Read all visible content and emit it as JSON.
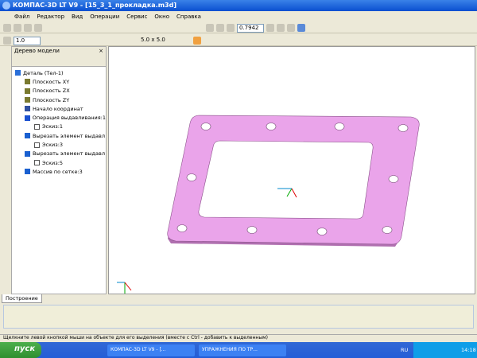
{
  "window": {
    "title": "КОМПАС-3D LT V9 - [15_3_1_прокладка.m3d]"
  },
  "menu": [
    "Файл",
    "Редактор",
    "Вид",
    "Операции",
    "Сервис",
    "Окно",
    "Справка"
  ],
  "toolbar": {
    "zoom": "0.7942",
    "line_step": "1.0",
    "grid": "5.0 x 5.0"
  },
  "tree": {
    "title": "Дерево модели",
    "items": [
      {
        "label": "Деталь (Тел-1)",
        "icon": "part-icon",
        "level": 0
      },
      {
        "label": "Плоскость XY",
        "icon": "plane-icon",
        "level": 1
      },
      {
        "label": "Плоскость ZX",
        "icon": "plane-icon",
        "level": 1
      },
      {
        "label": "Плоскость ZY",
        "icon": "plane-icon",
        "level": 1
      },
      {
        "label": "Начало координат",
        "icon": "origin-icon",
        "level": 1
      },
      {
        "label": "Операция выдавливания:1",
        "icon": "extrude-icon",
        "level": 1
      },
      {
        "label": "Эскиз:1",
        "icon": "sketch-icon",
        "level": 2
      },
      {
        "label": "Вырезать элемент выдавл",
        "icon": "cut-icon",
        "level": 1
      },
      {
        "label": "Эскиз:3",
        "icon": "sketch-icon",
        "level": 2
      },
      {
        "label": "Вырезать элемент выдавл",
        "icon": "cut-icon",
        "level": 1
      },
      {
        "label": "Эскиз:5",
        "icon": "sketch-icon",
        "level": 2
      },
      {
        "label": "Массив по сетке:3",
        "icon": "pattern-icon",
        "level": 1
      }
    ]
  },
  "bottom_tab": "Построение",
  "status": "Щелкните левой кнопкой мыши на объекте для его выделения (вместе с Ctrl - добавить к выделенным)",
  "taskbar": {
    "start": "пуск",
    "tasks": [
      "КОМПАС-3D LT V9 - [...",
      "УПРАЖНЕНИЯ ПО ТР..."
    ],
    "lang": "RU",
    "time": "14:18"
  },
  "colors": {
    "part": "#e8a0e8",
    "part_edge": "#a060a0"
  }
}
